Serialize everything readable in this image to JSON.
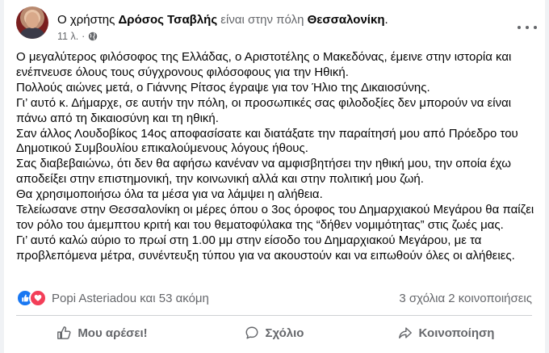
{
  "post": {
    "prefix": "Ο χρήστης",
    "author": "Δρόσος Τσαβλής",
    "middle": "είναι στην πόλη",
    "place": "Θεσσαλονίκη",
    "suffix": ".",
    "time": "11 λ.",
    "separator": "·",
    "privacy_icon": "globe-icon",
    "more_icon": "more-options-icon",
    "paragraphs": [
      "Ο μεγαλύτερος φιλόσοφος της Ελλάδας, ο Αριστοτέλης ο Μακεδόνας, έμεινε στην ιστορία και ενέπνευσε όλους τους σύγχρονους φιλόσοφους για την Ηθική.",
      "Πολλούς αιώνες μετά, ο Γιάννης Ρίτσος έγραψε για τον Ήλιο της Δικαιοσύνης.",
      "Γι’ αυτό κ. Δήμαρχε, σε αυτήν την πόλη, οι προσωπικές σας φιλοδοξίες δεν μπορούν να είναι πάνω από τη δικαιοσύνη και τη ηθική.",
      "Σαν άλλος Λουδοβίκος 14ος αποφασίσατε και διατάξατε την παραίτησή μου από Πρόεδρο του Δημοτικού Συμβουλίου επικαλούμενους λόγους ήθους.",
      "Σας διαβεβαιώνω, ότι δεν θα αφήσω κανέναν να αμφισβητήσει την ηθική μου, την οποία έχω αποδείξει στην επιστημονική, την κοινωνική αλλά και στην πολιτική μου ζωή.",
      "Θα χρησιμοποιήσω όλα τα μέσα για να λάμψει η αλήθεια.",
      "Τελείωσανε στην Θεσσαλονίκη οι μέρες όπου ο 3ος όροφος του Δημαρχιακού Μεγάρου θα παίζει τον ρόλο του άμεμπτου κριτή και του θεματοφύλακα της “δήθεν νομιμότητας” στις ζωές μας.",
      "Γι’ αυτό καλώ αύριο το πρωί στη 1.00  μμ στην είσοδο του Δημαρχιακού Μεγάρου, με τα προβλεπόμενα μέτρα, συνέντευξη τύπου για να ακουστούν και να ειπωθούν όλες οι αλήθειες."
    ]
  },
  "stats": {
    "reactions_text": "Popi Asteriadou και 53 ακόμη",
    "comments": "3 σχόλια",
    "shares": "2 κοινοποιήσεις",
    "reaction_icons": [
      "like-reaction-icon",
      "love-reaction-icon"
    ]
  },
  "actions": {
    "like_label": "Μου αρέσει!",
    "comment_label": "Σχόλιο",
    "share_label": "Κοινοποίηση"
  },
  "colors": {
    "background": "#f0f2f5",
    "card": "#ffffff",
    "text": "#050505",
    "muted": "#65676b",
    "like_blue": "#1877f2",
    "love_red": "#f33e58"
  }
}
